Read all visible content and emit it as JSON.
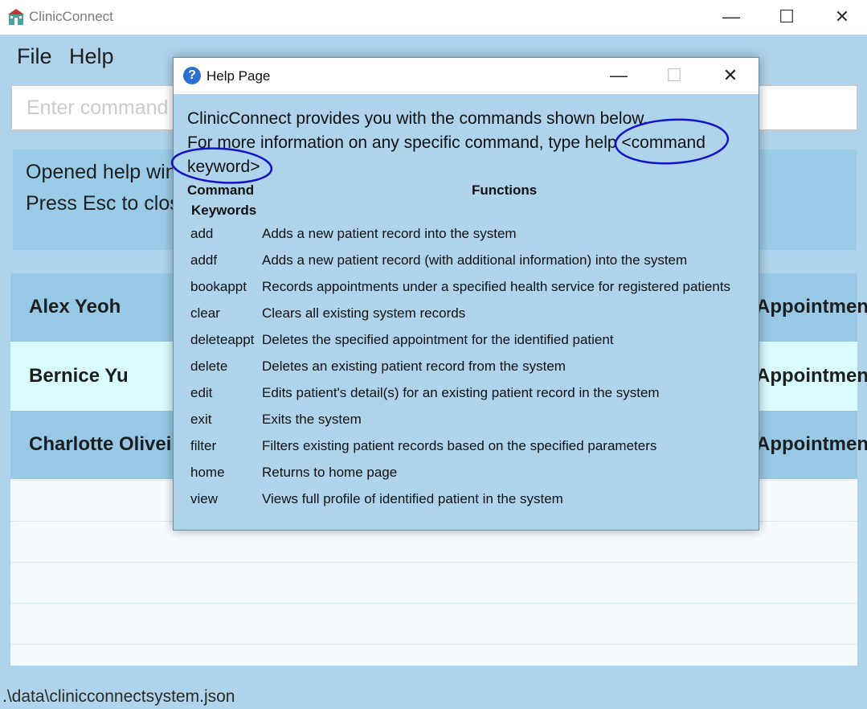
{
  "app": {
    "title": "ClinicConnect"
  },
  "window_controls": {
    "minimize": "—",
    "maximize": "☐",
    "close": "✕"
  },
  "menu": {
    "file": "File",
    "help": "Help"
  },
  "command": {
    "placeholder": "Enter command here..."
  },
  "result": {
    "line1": "Opened help window.",
    "line2": "Press Esc to close it."
  },
  "patients": [
    {
      "name": "Alex Yeoh",
      "right": "Appointment",
      "bg": "#97c8e5"
    },
    {
      "name": "Bernice Yu",
      "right": "Appointment",
      "bg": "#d8fbfd"
    },
    {
      "name": "Charlotte Oliveiro",
      "right": "Appointment",
      "bg": "#97c8e5"
    }
  ],
  "status": {
    "path": ".\\data\\clinicconnectsystem.json"
  },
  "help_dialog": {
    "title": "Help Page",
    "controls": {
      "minimize": "—",
      "maximize": "☐",
      "close": "✕"
    },
    "intro_line1": "ClinicConnect provides you with the commands shown below.",
    "intro_line2": "For more information on any specific command, type help <command",
    "intro_line3": "keyword>",
    "header_command_1": "Command",
    "header_command_2": "Keywords",
    "header_functions": "Functions",
    "commands": [
      {
        "key": "add",
        "desc": "Adds a new patient record into the system"
      },
      {
        "key": "addf",
        "desc": "Adds a new patient record (with additional information) into the system"
      },
      {
        "key": "bookappt",
        "desc": "Records appointments under a specified health service for registered patients"
      },
      {
        "key": "clear",
        "desc": "Clears all existing system records"
      },
      {
        "key": "deleteappt",
        "desc": "Deletes the specified appointment for the identified patient"
      },
      {
        "key": "delete",
        "desc": "Deletes an existing patient record from the system"
      },
      {
        "key": "edit",
        "desc": "Edits patient's detail(s) for an existing patient record in the system"
      },
      {
        "key": "exit",
        "desc": "Exits the system"
      },
      {
        "key": "filter",
        "desc": "Filters existing patient records based on the specified parameters"
      },
      {
        "key": "home",
        "desc": "Returns to home page"
      },
      {
        "key": "view",
        "desc": "Views full profile of identified patient in the system"
      }
    ]
  },
  "colors": {
    "accent_bg": "#aed3ea",
    "annotation_ink": "#1414c8"
  }
}
